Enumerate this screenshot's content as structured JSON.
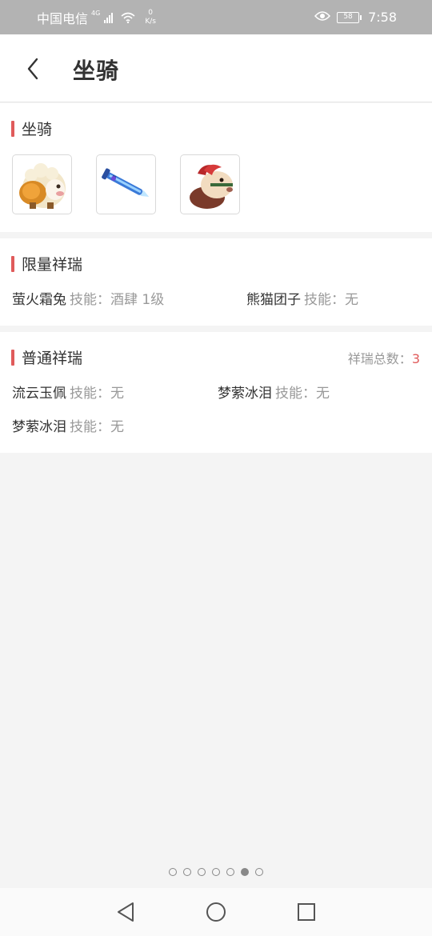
{
  "status_bar": {
    "carrier": "中国电信",
    "network_type": "4G",
    "speed_value": "0",
    "speed_unit": "K/s",
    "battery": "58",
    "time": "7:58"
  },
  "header": {
    "title": "坐骑"
  },
  "mounts_section": {
    "title": "坐骑",
    "items": [
      {
        "icon": "armored-sheep-mount-icon"
      },
      {
        "icon": "flying-sword-mount-icon"
      },
      {
        "icon": "horse-mount-icon"
      }
    ]
  },
  "limited_section": {
    "title": "限量祥瑞",
    "items": [
      {
        "name": "萤火霜兔",
        "skill": "技能：酒肆 1级"
      },
      {
        "name": "熊猫团子",
        "skill": "技能：无"
      }
    ]
  },
  "normal_section": {
    "title": "普通祥瑞",
    "total_label": "祥瑞总数：",
    "total_value": "3",
    "items": [
      {
        "name": "流云玉佩",
        "skill": "技能：无"
      },
      {
        "name": "梦萦冰泪",
        "skill": "技能：无"
      },
      {
        "name": "梦萦冰泪",
        "skill": "技能：无"
      }
    ]
  },
  "pagination": {
    "total": 7,
    "active": 6
  },
  "colors": {
    "accent": "#e05b5b",
    "status_bar": "#b3b3b3",
    "muted_text": "#999999"
  }
}
